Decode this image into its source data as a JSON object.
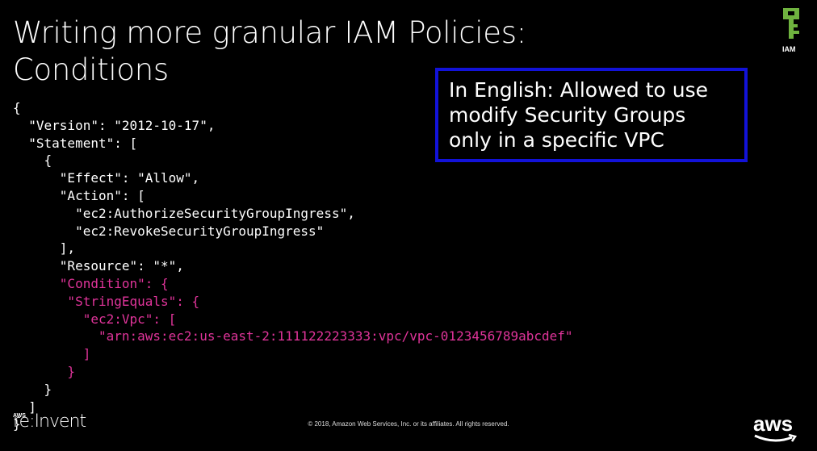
{
  "slide": {
    "title_line1": "Writing more granular IAM Policies:",
    "title_line2": "Conditions",
    "callout_text": "In English: Allowed to use\nmodify Security Groups\nonly in a specific VPC",
    "iam_label": "IAM",
    "reinvent_aws": "AWS",
    "reinvent_text": "re:Invent",
    "copyright": "© 2018, Amazon Web Services, Inc. or its affiliates. All rights reserved.",
    "aws_logo": "aws",
    "colors": {
      "background": "#000000",
      "code_default": "#ffffff",
      "code_condition": "#e0349a",
      "callout_border": "#1212d8",
      "iam_icon": "#6fb33f"
    },
    "code_lines": [
      {
        "text": "{",
        "kind": "normal"
      },
      {
        "text": "  \"Version\": \"2012-10-17\",",
        "kind": "normal"
      },
      {
        "text": "  \"Statement\": [",
        "kind": "normal"
      },
      {
        "text": "    {",
        "kind": "normal"
      },
      {
        "text": "      \"Effect\": \"Allow\",",
        "kind": "normal"
      },
      {
        "text": "      \"Action\": [",
        "kind": "normal"
      },
      {
        "text": "        \"ec2:AuthorizeSecurityGroupIngress\",",
        "kind": "normal"
      },
      {
        "text": "        \"ec2:RevokeSecurityGroupIngress\"",
        "kind": "normal"
      },
      {
        "text": "      ],",
        "kind": "normal"
      },
      {
        "text": "      \"Resource\": \"*\",",
        "kind": "normal"
      },
      {
        "text": "      \"Condition\": {",
        "kind": "condition"
      },
      {
        "text": "       \"StringEquals\": {",
        "kind": "condition"
      },
      {
        "text": "         \"ec2:Vpc\": [",
        "kind": "condition"
      },
      {
        "text": "           \"arn:aws:ec2:us-east-2:111122223333:vpc/vpc-0123456789abcdef\"",
        "kind": "condition"
      },
      {
        "text": "         ]",
        "kind": "condition"
      },
      {
        "text": "       }",
        "kind": "condition"
      },
      {
        "text": "    }",
        "kind": "normal"
      },
      {
        "text": "  ]",
        "kind": "normal"
      },
      {
        "text": "}",
        "kind": "normal"
      }
    ]
  }
}
